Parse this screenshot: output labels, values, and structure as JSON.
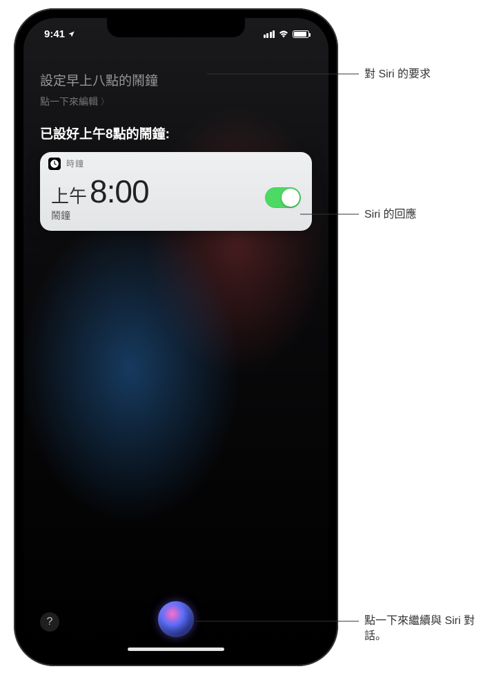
{
  "status": {
    "time": "9:41",
    "location_active": true
  },
  "siri": {
    "request_text": "設定早上八點的鬧鐘",
    "edit_hint": "點一下來編輯",
    "response_text": "已設好上午8點的鬧鐘:"
  },
  "alarm_card": {
    "app_name": "時鐘",
    "ampm": "上午",
    "time": "8:00",
    "label": "鬧鐘",
    "enabled": true
  },
  "callouts": {
    "request": "對 Siri 的要求",
    "response": "Siri 的回應",
    "continue": "點一下來繼續與 Siri 對話。"
  },
  "help_glyph": "?"
}
